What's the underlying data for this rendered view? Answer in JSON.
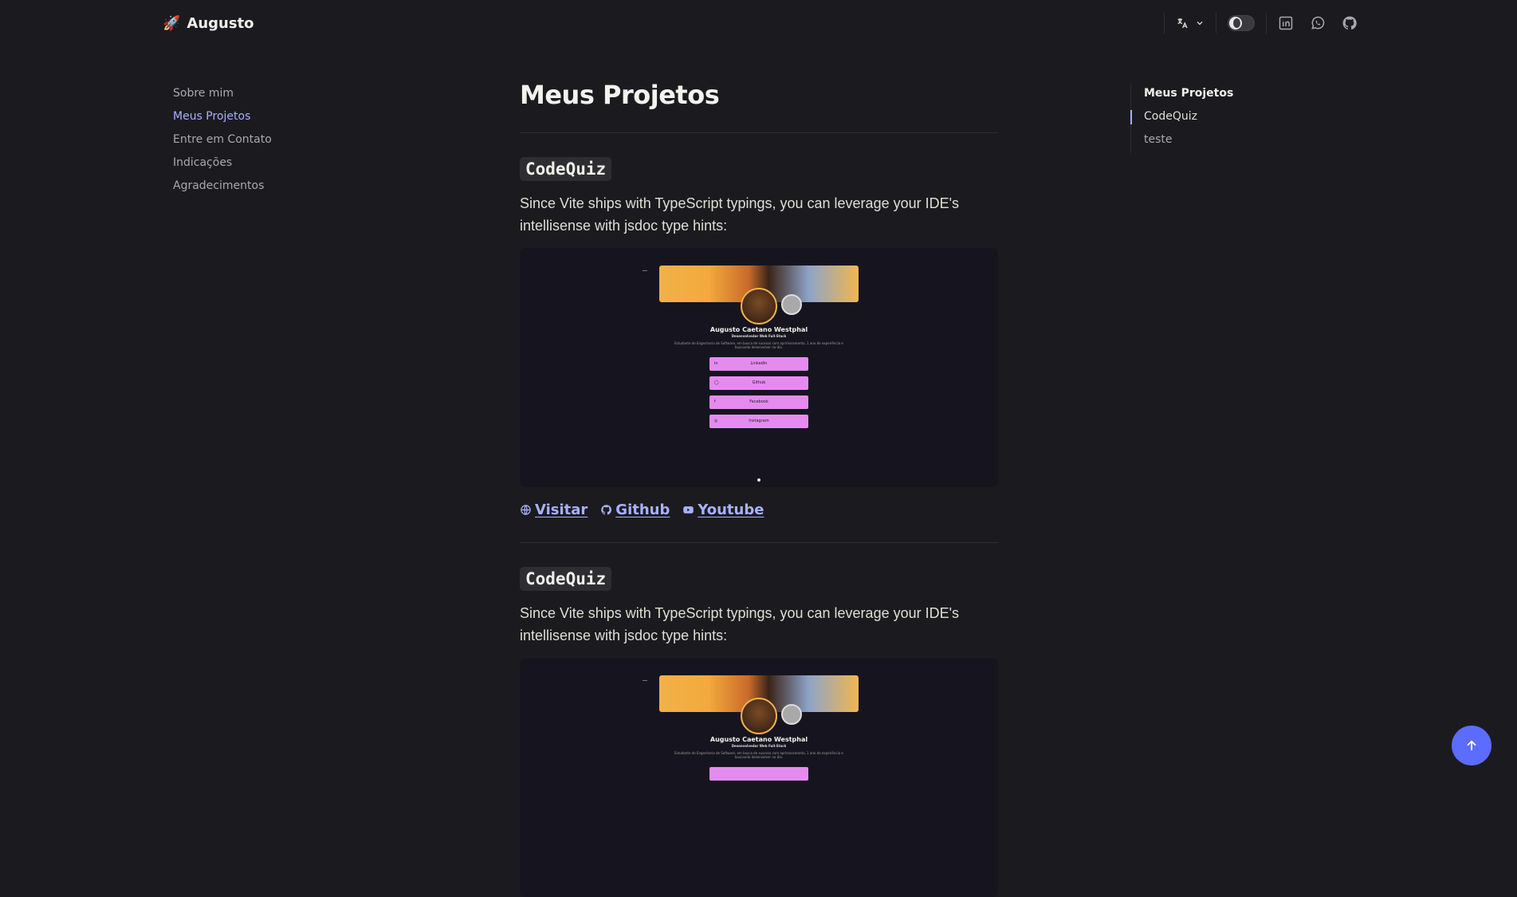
{
  "brand": {
    "icon": "rocket-emoji",
    "emoji": "🚀",
    "name": "Augusto"
  },
  "navbar": {
    "language_icon": "translate-icon",
    "theme_toggle": "dark",
    "social": [
      "linkedin-icon",
      "whatsapp-icon",
      "github-icon"
    ]
  },
  "sidebar": {
    "items": [
      {
        "label": "Sobre mim"
      },
      {
        "label": "Meus Projetos",
        "active": true
      },
      {
        "label": "Entre em Contato"
      },
      {
        "label": "Indicações"
      },
      {
        "label": "Agradecimentos"
      }
    ]
  },
  "main": {
    "title": "Meus Projetos",
    "projects": [
      {
        "title": "CodeQuiz",
        "description": "Since Vite ships with TypeScript typings, you can leverage your IDE's intellisense with jsdoc type hints:",
        "preview": {
          "name": "Augusto Caetano Westphal",
          "role": "Desenvolvedor Web Full-Stack",
          "bio": "Estudante de Engenharia de Software, em busca de sucesso com aprimoramento, 1 ano de experiência e buscando desenvolver no dia.",
          "buttons": [
            "LinkedIn",
            "Github",
            "Facebook",
            "Instagram"
          ]
        },
        "links": [
          {
            "label": "Visitar",
            "icon": "globe-icon"
          },
          {
            "label": "Github",
            "icon": "github-icon"
          },
          {
            "label": "Youtube",
            "icon": "youtube-icon"
          }
        ]
      },
      {
        "title": "CodeQuiz",
        "description": "Since Vite ships with TypeScript typings, you can leverage your IDE's intellisense with jsdoc type hints:",
        "preview": {
          "name": "Augusto Caetano Westphal",
          "role": "Desenvolvedor Web Full-Stack",
          "bio": "Estudante de Engenharia de Software, em busca de sucesso com aprimoramento, 1 ano de experiência e buscando desenvolver no dia."
        }
      }
    ]
  },
  "toc": {
    "items": [
      {
        "label": "Meus Projetos"
      },
      {
        "label": "CodeQuiz",
        "active": true
      },
      {
        "label": "teste"
      }
    ]
  },
  "colors": {
    "background": "#1b1b1f",
    "accent": "#a8b1ff",
    "button": "#5c6cff",
    "preview_button": "#e58bf0"
  },
  "back_to_top_icon": "arrow-up-icon"
}
